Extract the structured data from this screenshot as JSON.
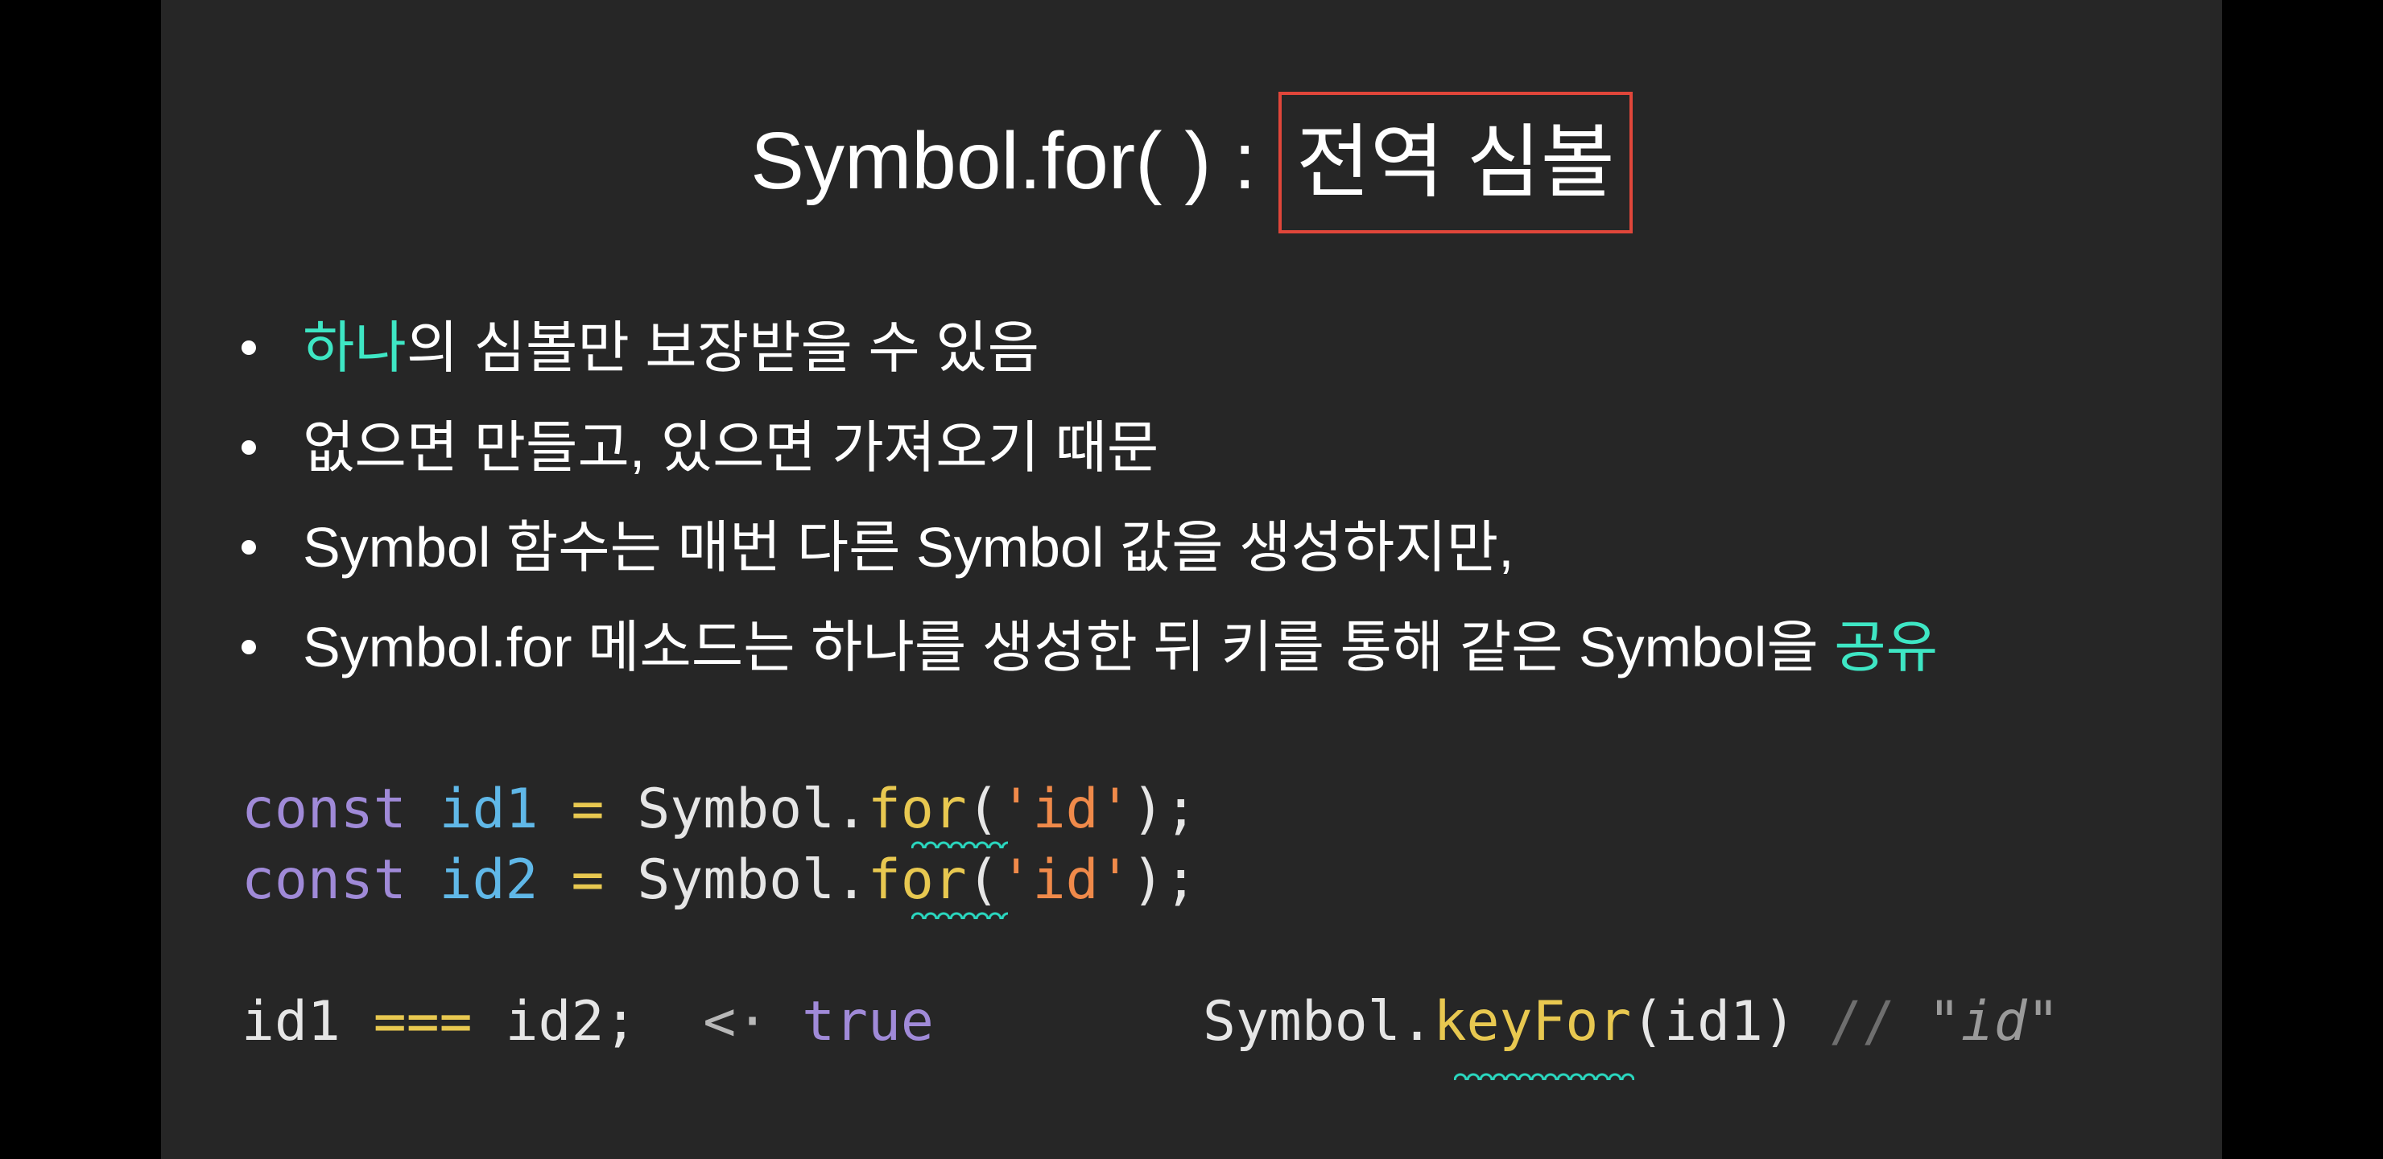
{
  "slide": {
    "title_prefix": "Symbol.for( ) : ",
    "title_boxed": "전역 심볼",
    "bullets": [
      {
        "accent": "하나",
        "text": "의 심볼만 보장받을 수 있음"
      },
      {
        "text": "없으면 만들고, 있으면 가져오기 때문"
      },
      {
        "text": "Symbol 함수는 매번 다른 Symbol 값을 생성하지만,"
      },
      {
        "text": "Symbol.for 메소드는 하나를 생성한 뒤 키를 통해 같은 Symbol을 ",
        "accent": "공유"
      }
    ],
    "code": {
      "line1": {
        "kw": "const",
        "var": "id1",
        "op": "=",
        "obj": "Symbol.",
        "fn": "for",
        "open": "(",
        "str": "'id'",
        "close": ");"
      },
      "line2": {
        "kw": "const",
        "var": "id2",
        "op": "=",
        "obj": "Symbol.",
        "fn": "for",
        "open": "(",
        "str": "'id'",
        "close": ");"
      },
      "compare": {
        "expr_a": "id1",
        "op": "===",
        "expr_b": "id2;",
        "arrow": "<·",
        "result": "true"
      },
      "keyfor": {
        "obj": "Symbol.",
        "fn": "keyFor",
        "args": "(id1)",
        "comment": "// ",
        "comment_str": "\"id\""
      }
    },
    "colors": {
      "background": "#262626",
      "accent": "#3ee6c4",
      "title_box": "#e0463a"
    }
  }
}
